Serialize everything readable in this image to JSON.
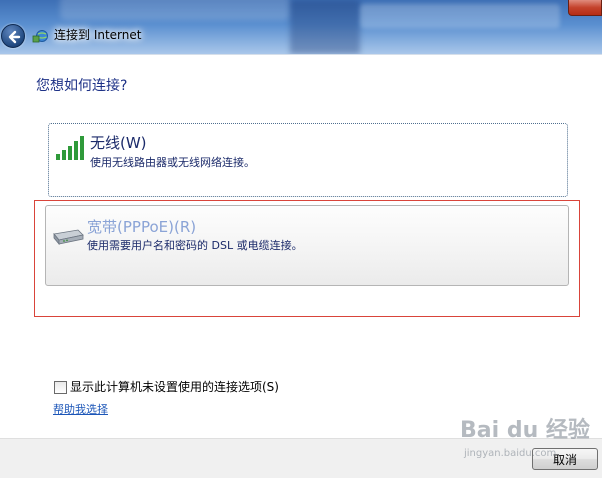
{
  "window": {
    "title": "连接到 Internet"
  },
  "page": {
    "heading": "您想如何连接?"
  },
  "options": [
    {
      "title": "无线(W)",
      "description": "使用无线路由器或无线网络连接。",
      "icon": "wireless-signal-icon"
    },
    {
      "title": "宽带(PPPoE)(R)",
      "description": "使用需要用户名和密码的 DSL 或电缆连接。",
      "icon": "broadband-modem-icon"
    }
  ],
  "show_unsetup": {
    "label": "显示此计算机未设置使用的连接选项(S)",
    "checked": false
  },
  "help_link": "帮助我选择",
  "footer": {
    "cancel_label": "取消"
  },
  "watermark": {
    "logo": "Bai du 经验",
    "url": "jingyan.baidu.com"
  },
  "colors": {
    "heading": "#1e3287",
    "link": "#1c56b8",
    "highlight_frame": "#d9443a",
    "wireless_bars": "#2f9a3a"
  }
}
